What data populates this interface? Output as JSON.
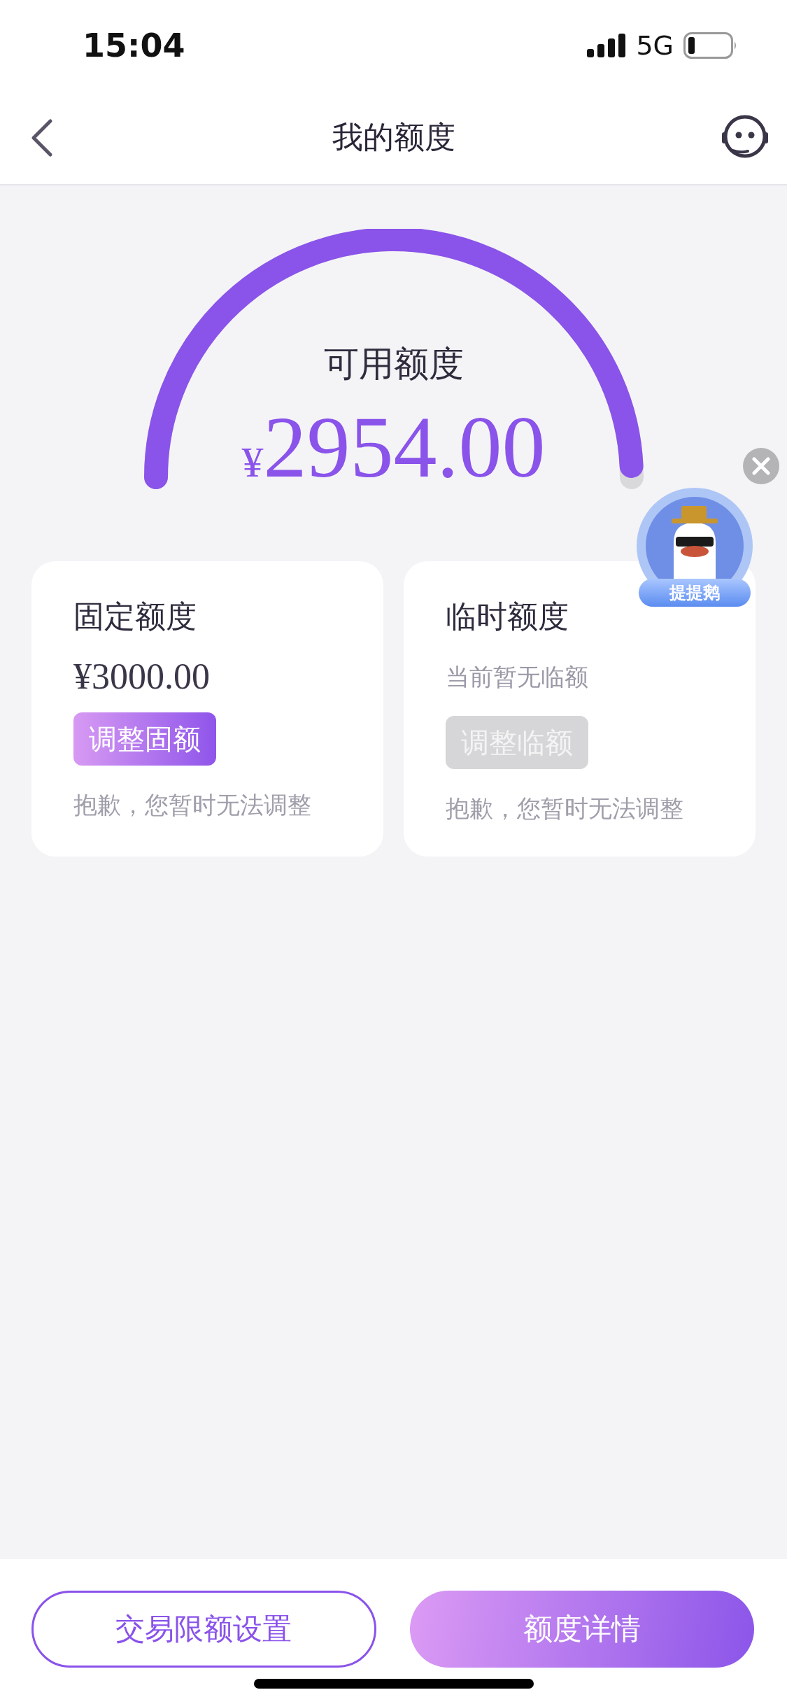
{
  "status_bar": {
    "time": "15:04",
    "network": "5G"
  },
  "nav": {
    "title": "我的额度"
  },
  "gauge": {
    "label": "可用额度",
    "currency": "¥",
    "amount": "2954.00"
  },
  "cards": [
    {
      "kind": "amount",
      "title": "固定额度",
      "value": "¥3000.00",
      "button": {
        "label": "调整固额",
        "disabled": false
      },
      "message": "抱歉，您暂时无法调整"
    },
    {
      "kind": "note",
      "title": "临时额度",
      "value": "当前暂无临额",
      "button": {
        "label": "调整临额",
        "disabled": true
      },
      "message": "抱歉，您暂时无法调整"
    }
  ],
  "floating_badge": {
    "label": "提提鹅"
  },
  "bottom_buttons": [
    {
      "kind": "outline",
      "label": "交易限额设置"
    },
    {
      "kind": "filled",
      "label": "额度详情"
    }
  ]
}
